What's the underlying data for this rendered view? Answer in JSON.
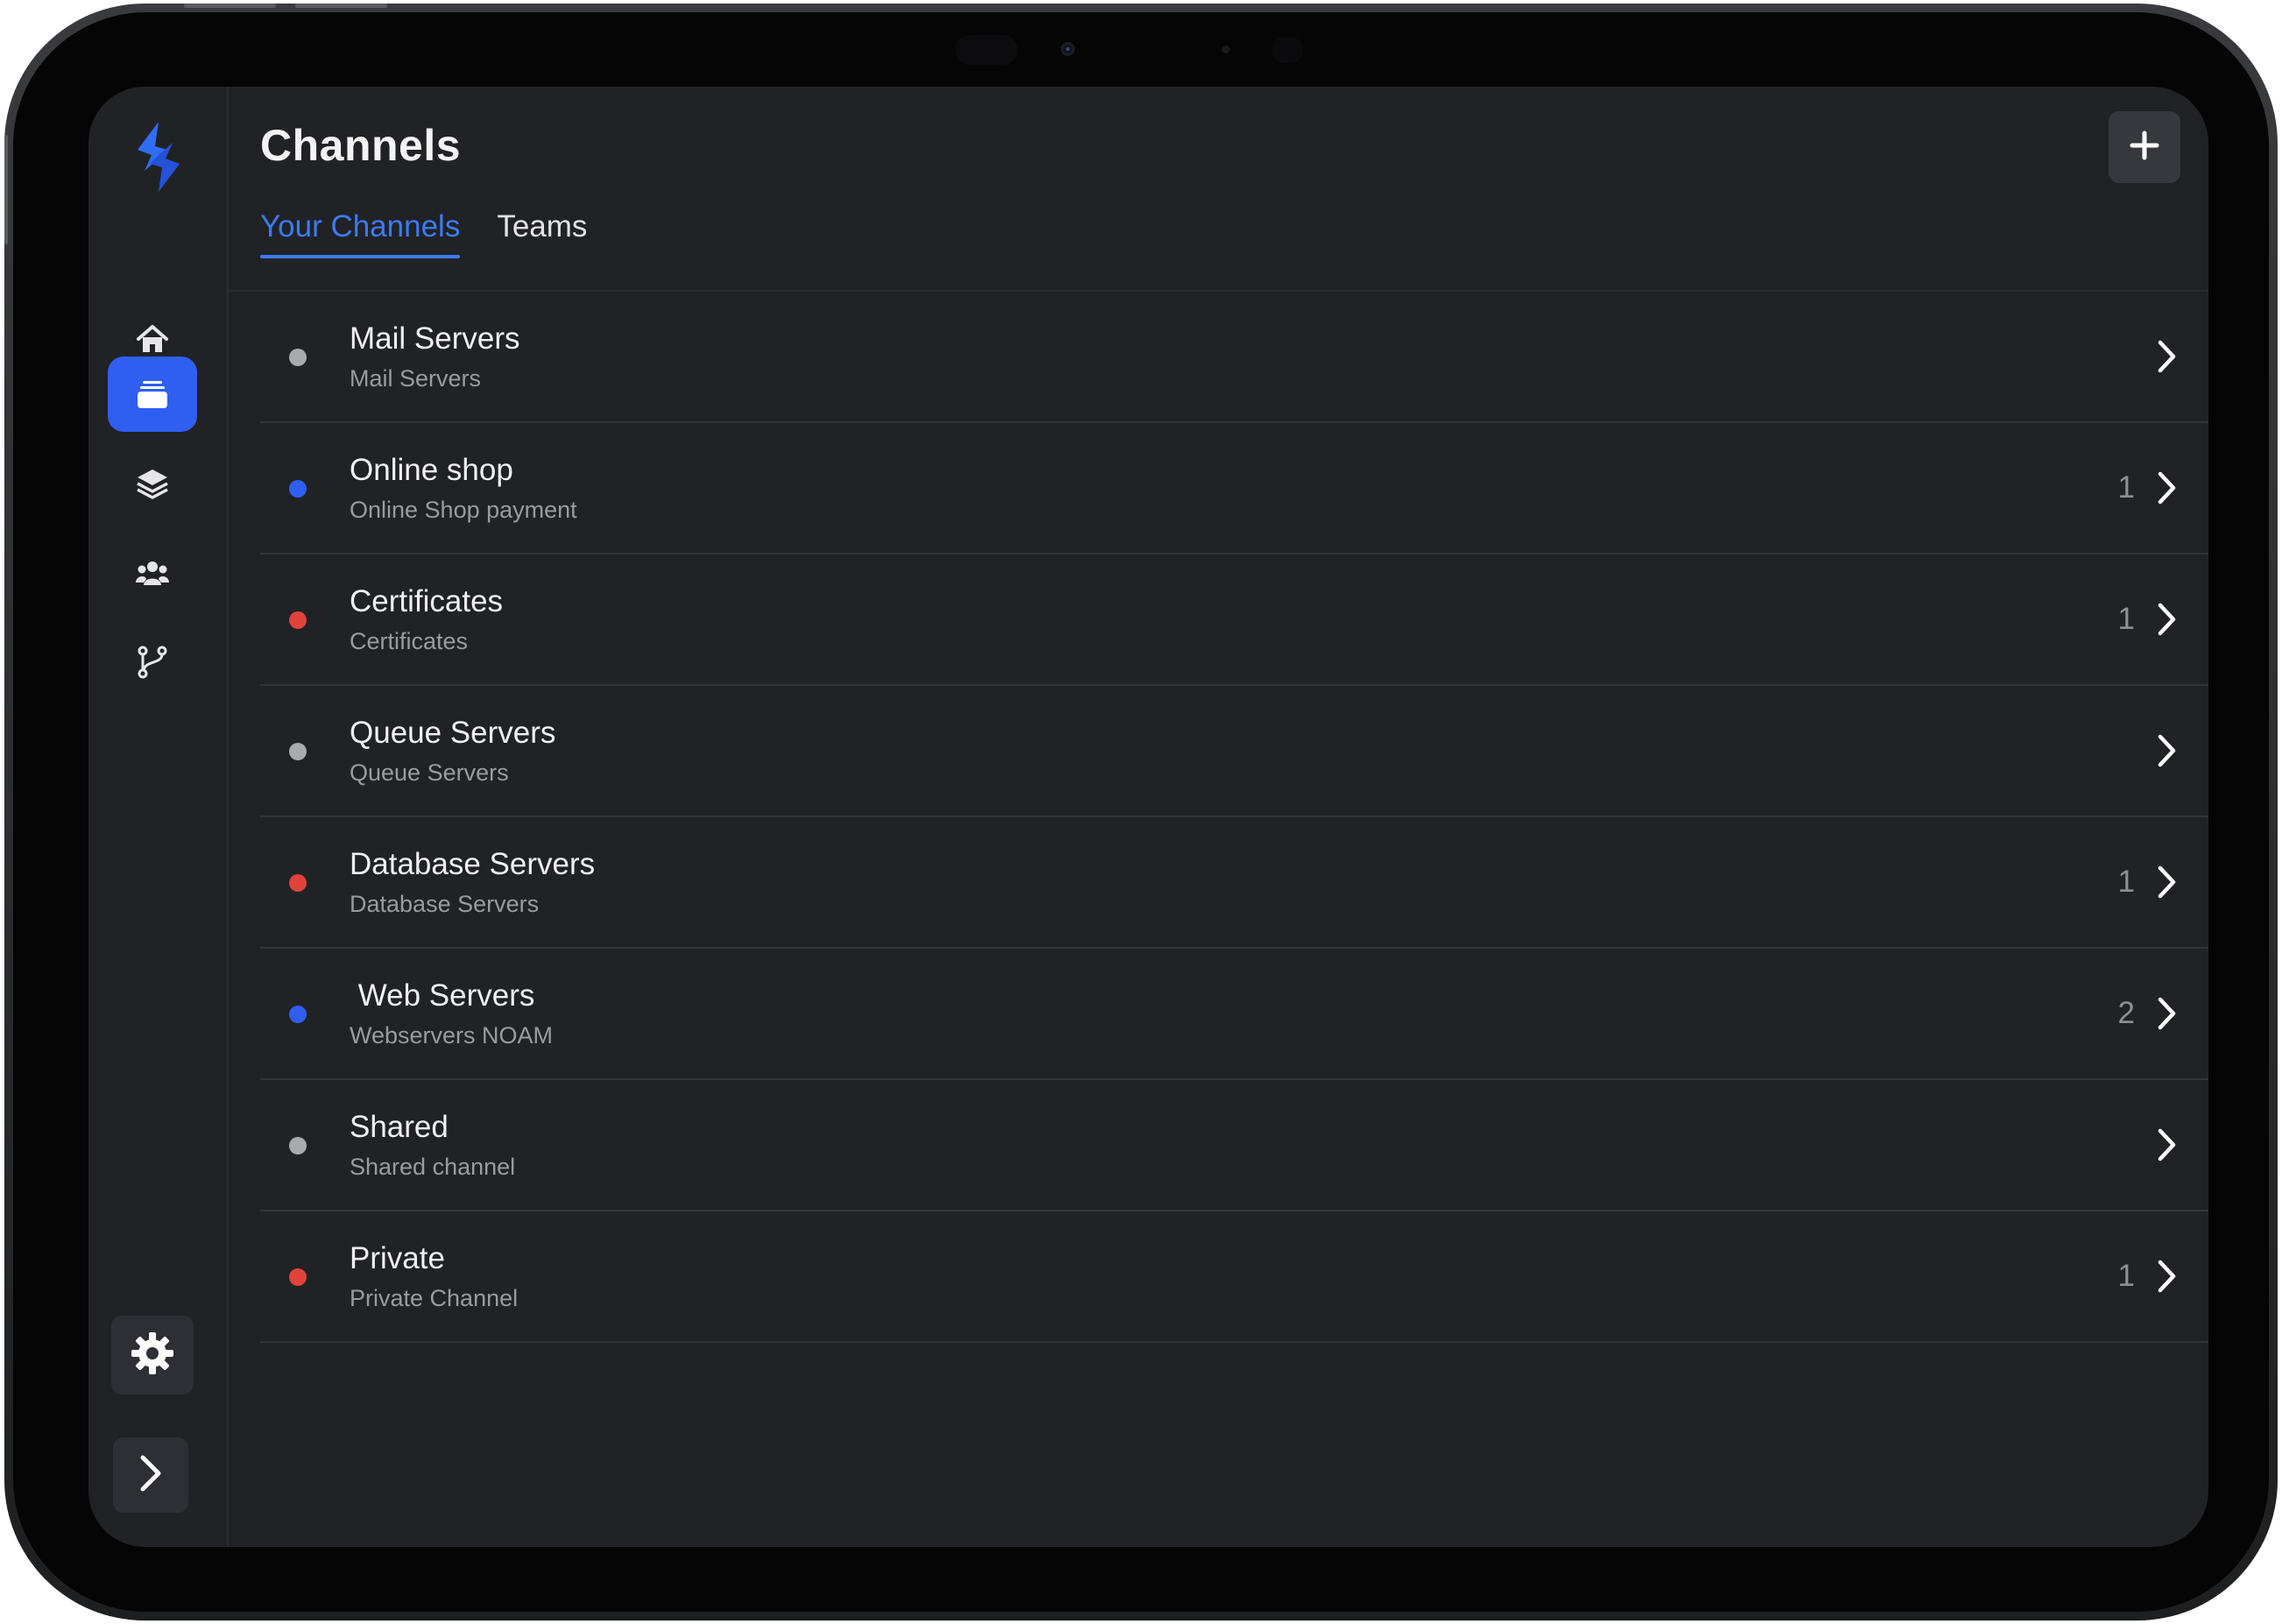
{
  "app": {
    "page_title": "Channels",
    "add_button_label": "+"
  },
  "tabs": [
    {
      "label": "Your Channels",
      "active": true
    },
    {
      "label": "Teams",
      "active": false
    }
  ],
  "sidebar": {
    "items": [
      {
        "name": "home",
        "icon": "home-icon",
        "active": false
      },
      {
        "name": "channels",
        "icon": "inbox-icon",
        "active": true
      },
      {
        "name": "layers",
        "icon": "layers-icon",
        "active": false
      },
      {
        "name": "teams",
        "icon": "users-icon",
        "active": false
      },
      {
        "name": "workflows",
        "icon": "branch-icon",
        "active": false
      }
    ],
    "bottom": [
      {
        "name": "settings",
        "icon": "gear-icon"
      },
      {
        "name": "expand",
        "icon": "chevron-right-icon"
      }
    ]
  },
  "colors": {
    "accent": "#2f5ef1",
    "tab_active": "#3c7bf2",
    "status_gray": "#a9aaae",
    "status_blue": "#2f5ef1",
    "status_red": "#e0433b",
    "background": "#212226"
  },
  "channels": [
    {
      "name": "Mail Servers",
      "description": "Mail Servers",
      "count": "",
      "status": "gray"
    },
    {
      "name": "Online shop",
      "description": "Online Shop payment",
      "count": "1",
      "status": "blue"
    },
    {
      "name": "Certificates",
      "description": "Certificates",
      "count": "1",
      "status": "red"
    },
    {
      "name": "Queue Servers",
      "description": "Queue Servers",
      "count": "",
      "status": "gray"
    },
    {
      "name": "Database Servers",
      "description": "Database Servers",
      "count": "1",
      "status": "red"
    },
    {
      "name": " Web Servers",
      "description": "Webservers NOAM",
      "count": "2",
      "status": "blue"
    },
    {
      "name": "Shared",
      "description": "Shared channel",
      "count": "",
      "status": "gray"
    },
    {
      "name": "Private",
      "description": "Private Channel",
      "count": "1",
      "status": "red"
    }
  ]
}
